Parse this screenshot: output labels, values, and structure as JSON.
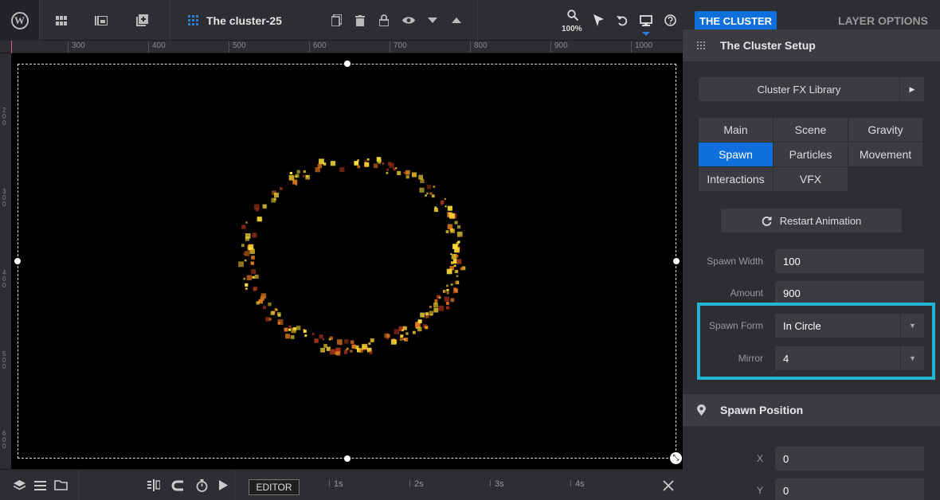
{
  "toolbar": {
    "title": "The cluster-25",
    "zoom": "100%",
    "wp_logo_glyph": "W",
    "icons": [
      "grid-icon",
      "media-icon",
      "add-icon",
      "layers-grid-icon",
      "copy-icon",
      "trash-icon",
      "lock-icon",
      "eye-icon",
      "arrow-down-icon",
      "arrow-up-icon",
      "search-icon",
      "cursor-icon",
      "undo-icon",
      "desktop-icon",
      "help-icon"
    ]
  },
  "ruler": {
    "labels": [
      "300",
      "400",
      "500",
      "600",
      "700",
      "800",
      "900",
      "1000"
    ],
    "vlabels": [
      "200",
      "300",
      "400",
      "500",
      "600"
    ]
  },
  "timeline": {
    "editor_label": "EDITOR",
    "marks": [
      "1s",
      "2s",
      "3s",
      "4s"
    ]
  },
  "panel": {
    "tab_active": "THE CLUSTER",
    "tab_inactive": "LAYER OPTIONS",
    "setup_title": "The Cluster Setup",
    "fx_library": "Cluster FX Library",
    "tabs": [
      "Main",
      "Scene",
      "Gravity",
      "Spawn",
      "Particles",
      "Movement",
      "Interactions",
      "VFX"
    ],
    "active_tab": "Spawn",
    "restart_label": "Restart Animation",
    "spawn_width_label": "Spawn Width",
    "spawn_width_value": "100",
    "amount_label": "Amount",
    "amount_value": "900",
    "spawn_form_label": "Spawn Form",
    "spawn_form_value": "In Circle",
    "mirror_label": "Mirror",
    "mirror_value": "4",
    "position_title": "Spawn Position",
    "x_label": "X",
    "x_value": "0",
    "y_label": "Y",
    "y_value": "0"
  },
  "colors": {
    "accent": "#0f6fdc",
    "highlight": "#23b5d3",
    "particle_yellow": "#ffe23a",
    "particle_orange": "#e0781c",
    "particle_red": "#a8331a"
  }
}
